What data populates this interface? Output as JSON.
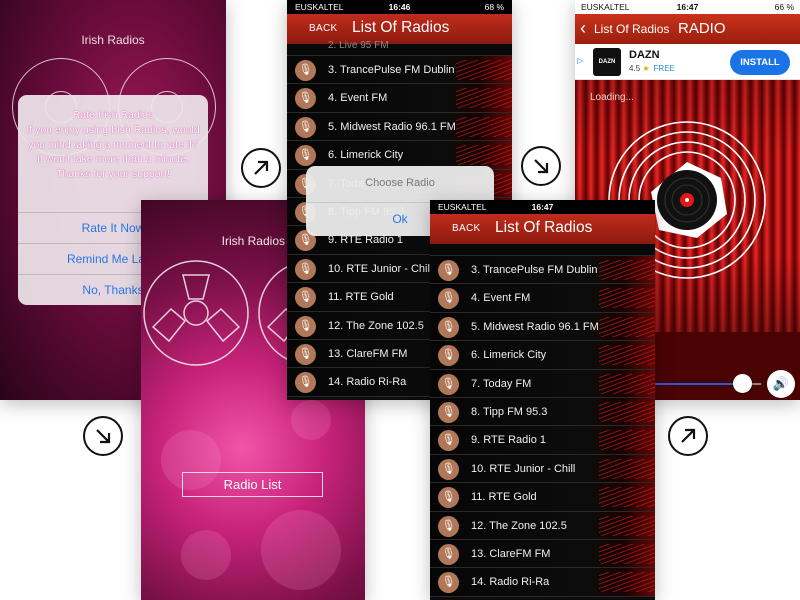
{
  "screen1": {
    "title": "Irish Radios",
    "dialog": {
      "title": "Rate Irish Radios",
      "message": "If you enjoy using Irish Radios, would you mind taking a moment to rate it? It won't take more than a minute. Thanks for your support!",
      "buttons": [
        "Rate It Now",
        "Remind Me Later",
        "No, Thanks"
      ]
    }
  },
  "screen2": {
    "title": "Irish Radios",
    "radio_list_button": "Radio List"
  },
  "screen3": {
    "status": {
      "carrier": "EUSKALTEL",
      "time": "16:46",
      "battery": "68 %"
    },
    "header": {
      "back": "BACK",
      "title": "List Of Radios"
    },
    "partial_item": "2. Live 95 FM",
    "items": [
      "3. TrancePulse FM Dublin",
      "4. Event FM",
      "5. Midwest Radio 96.1 FM",
      "6. Limerick City",
      "7. Today FM",
      "8. Tipp FM 95.3",
      "9. RTE Radio 1",
      "10. RTE Junior - Chill",
      "11. RTE Gold",
      "12. The Zone 102.5",
      "13. ClareFM FM",
      "14. Radio Ri-Ra"
    ],
    "dialog": {
      "title": "Choose Radio",
      "ok": "Ok"
    }
  },
  "screen4": {
    "status": {
      "carrier": "EUSKALTEL",
      "time": "16:47"
    },
    "header": {
      "back": "BACK",
      "title": "List Of Radios"
    },
    "items": [
      "3. TrancePulse FM Dublin",
      "4. Event FM",
      "5. Midwest Radio 96.1 FM",
      "6. Limerick City",
      "7. Today FM",
      "8. Tipp FM 95.3",
      "9. RTE Radio 1",
      "10. RTE Junior - Chill",
      "11. RTE Gold",
      "12. The Zone 102.5",
      "13. ClareFM FM",
      "14. Radio Ri-Ra"
    ]
  },
  "screen5": {
    "status": {
      "carrier": "EUSKALTEL",
      "time": "16:47",
      "battery": "66 %"
    },
    "header": {
      "back": "List Of Radios",
      "title": "RADIO"
    },
    "ad": {
      "name": "DAZN",
      "rating": "4.5",
      "price": "FREE",
      "install": "INSTALL",
      "logo": "DAZN"
    },
    "loading": "Loading...",
    "volume_level": 0.87
  },
  "flow_arrows": [
    "arrow-up-right-icon",
    "arrow-down-right-icon",
    "arrow-down-right-icon",
    "arrow-up-right-icon"
  ]
}
